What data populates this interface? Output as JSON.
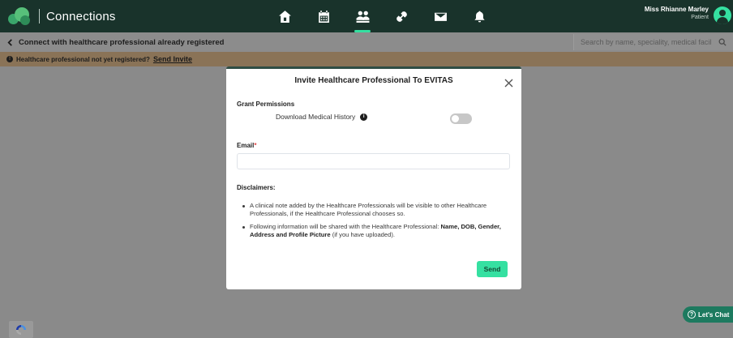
{
  "header": {
    "title": "Connections",
    "nav_icons": [
      "home-icon",
      "calendar-icon",
      "people-icon",
      "link-icon",
      "mail-icon",
      "bell-icon"
    ],
    "active_nav": "people-icon",
    "user": {
      "name": "Miss Rhianne Marley",
      "role": "Patient"
    }
  },
  "subbar": {
    "back_label": "Connect with healthcare professional already registered",
    "search_placeholder": "Search by name, speciality, medical facil"
  },
  "banner": {
    "question": "Healthcare professional not yet registered?",
    "link": "Send Invite"
  },
  "modal": {
    "title": "Invite Healthcare Professional To EVITAS",
    "permissions_label": "Grant Permissions",
    "permission_item": "Download Medical History",
    "permission_enabled": false,
    "email_label": "Email",
    "email_required_mark": "*",
    "email_value": "",
    "disclaimers_label": "Disclaimers:",
    "disclaimer_1": "A clinical note added by the Healthcare Professionals will be visible to other Healthcare Professionals, if the Healthcare Professional chooses so.",
    "disclaimer_2_prefix": "Following information will be shared with the Healthcare Professional:",
    "disclaimer_2_bold": "Name, DOB, Gender, Address and Profile Picture",
    "disclaimer_2_suffix": "(if you have uploaded).",
    "send_label": "Send"
  },
  "chat": {
    "label": "Let's Chat"
  },
  "colors": {
    "nav_bg": "#19332b",
    "accent": "#35e0a1",
    "chat_bg": "#1d7a5f",
    "overlay_banner": "#8a7357"
  }
}
